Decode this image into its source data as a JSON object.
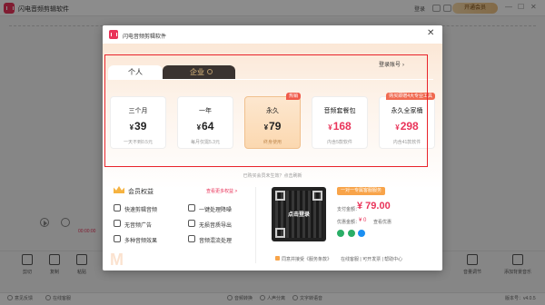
{
  "app": {
    "title": "闪电音频剪辑软件",
    "login": "登录",
    "vip_button": "开通会员",
    "min": "—",
    "max": "☐",
    "close": "✕",
    "time": "00:00:00",
    "toolbar": [
      {
        "label": "剪切",
        "icon": "scissors-icon"
      },
      {
        "label": "复制",
        "icon": "copy-icon"
      },
      {
        "label": "粘贴",
        "icon": "paste-icon"
      },
      {
        "label": "音量调节",
        "icon": "volume-icon"
      },
      {
        "label": "添加背景音乐",
        "icon": "music-icon"
      }
    ],
    "status": [
      "意见反馈",
      "在线客服",
      "音频转换",
      "人声分离",
      "文字转语音"
    ],
    "version": "版本号：v4.0.5"
  },
  "modal": {
    "title": "闪电音频剪辑软件",
    "close": "✕",
    "tabs": {
      "personal": "个人",
      "enterprise": "企业"
    },
    "login_link": "登录账号",
    "plans": [
      {
        "name": "三个月",
        "currency": "¥",
        "price": "39",
        "desc": "一天不到0.5元",
        "badge": ""
      },
      {
        "name": "一年",
        "currency": "¥",
        "price": "64",
        "desc": "每月仅需5.3元",
        "badge": ""
      },
      {
        "name": "永久",
        "currency": "¥",
        "price": "79",
        "desc": "终身使用",
        "badge": "热销"
      },
      {
        "name": "音频套餐包",
        "currency": "¥",
        "price": "168",
        "desc": "内含5款软件",
        "badge": ""
      },
      {
        "name": "永久全家桶",
        "currency": "¥",
        "price": "298",
        "desc": "内含41款软件",
        "badge": "购买即赠4大专业工具"
      }
    ],
    "restore": "已购买会员未生效？点击刷新",
    "benefits": {
      "title": "会员权益",
      "more": "查看更多权益 >",
      "items": [
        {
          "label": "快速剪辑音频",
          "icon": "scissors-icon"
        },
        {
          "label": "一键处理降噪",
          "icon": "noise-icon"
        },
        {
          "label": "无音频广告",
          "icon": "no-ads-icon"
        },
        {
          "label": "无损音质导出",
          "icon": "export-icon"
        },
        {
          "label": "多种音频效果",
          "icon": "effect-icon"
        },
        {
          "label": "音频混流处理",
          "icon": "mix-icon"
        }
      ],
      "watermark": "M"
    },
    "qr": {
      "text": "点击登录"
    },
    "pay": {
      "tag": "一对一专属客服服务",
      "amount_label": "支付金额：",
      "amount": "¥ 79.00",
      "discount_label": "优惠金额：",
      "discount": "¥ 0",
      "discount_more": "查看优惠"
    },
    "agreement": "同意并接受《服务条款》",
    "help": "在线客服 | 可开发票 | 帮助中心",
    "colors": {
      "accent": "#e9345a",
      "gold": "#f0c986",
      "dark_tab": "#3a3330",
      "highlight": "#e8232a"
    }
  }
}
